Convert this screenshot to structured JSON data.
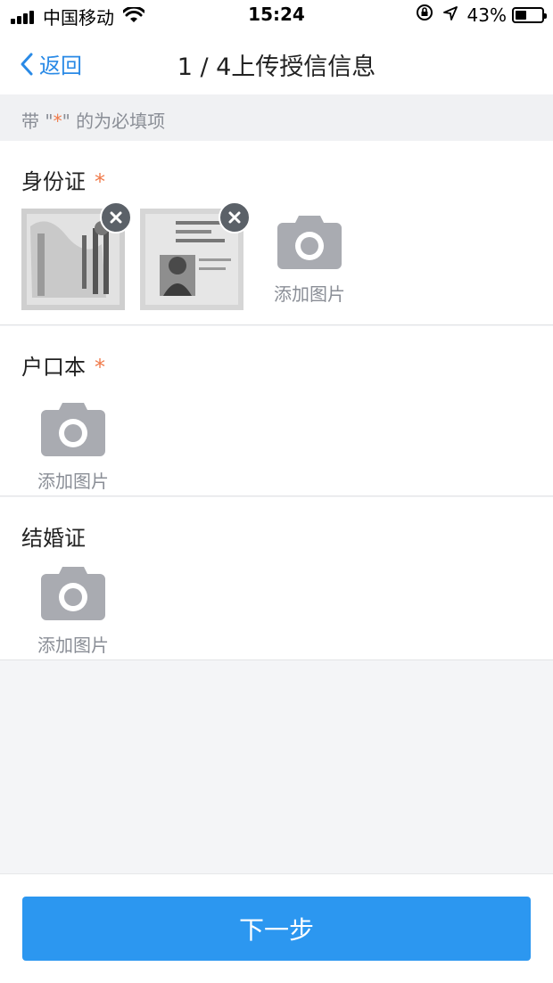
{
  "status_bar": {
    "carrier": "中国移动",
    "time": "15:24",
    "battery_percent_label": "43%",
    "battery_level": 0.43,
    "icons": [
      "signal-icon",
      "wifi-icon",
      "rotation-lock-icon",
      "location-icon",
      "battery-icon"
    ]
  },
  "nav": {
    "back_label": "返回",
    "title": "1 / 4上传授信信息"
  },
  "hint": {
    "prefix": "带 \"",
    "star": "*",
    "suffix": "\" 的为必填项"
  },
  "sections": [
    {
      "label": "身份证",
      "required_mark": "*",
      "add_label": "添加图片",
      "photos": [
        "id-card-front",
        "id-card-back"
      ]
    },
    {
      "label": "户口本",
      "required_mark": "*",
      "add_label": "添加图片",
      "photos": []
    },
    {
      "label": "结婚证",
      "required_mark": "",
      "add_label": "添加图片",
      "photos": []
    }
  ],
  "footer": {
    "next_label": "下一步"
  },
  "colors": {
    "accent": "#2c97f0",
    "nav_link": "#2a8ae6",
    "required": "#f07a4a",
    "muted_text": "#8a8e96",
    "camera_icon": "#a9abb1"
  }
}
